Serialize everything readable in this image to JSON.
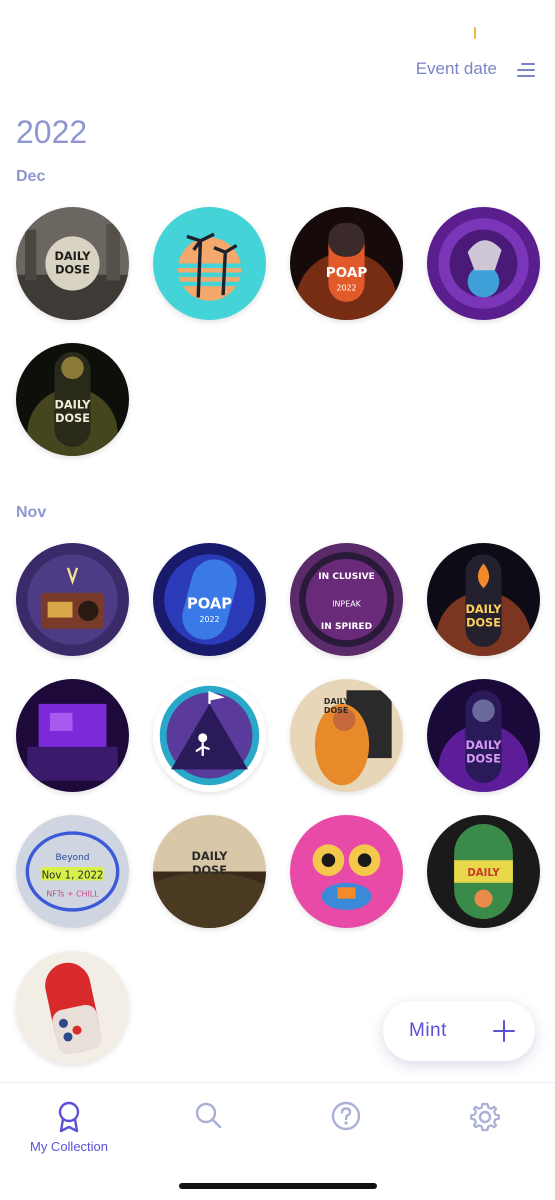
{
  "header": {
    "sort_label": "Event date",
    "sort_icon": "sort-lines-icon"
  },
  "year": "2022",
  "groups": [
    {
      "month": "Dec",
      "badge_count": 5
    },
    {
      "month": "Nov",
      "badge_count": 13
    }
  ],
  "fab": {
    "label": "Mint",
    "icon": "plus-icon"
  },
  "tabs": [
    {
      "label": "My Collection",
      "icon": "ribbon-award-icon",
      "active": true
    },
    {
      "label": "",
      "icon": "search-icon",
      "active": false
    },
    {
      "label": "",
      "icon": "help-circle-icon",
      "active": false
    },
    {
      "label": "",
      "icon": "gear-icon",
      "active": false
    }
  ],
  "colors": {
    "accent": "#5b51d8",
    "muted": "#7b84c4",
    "inactive_icon": "#aab0d6"
  }
}
